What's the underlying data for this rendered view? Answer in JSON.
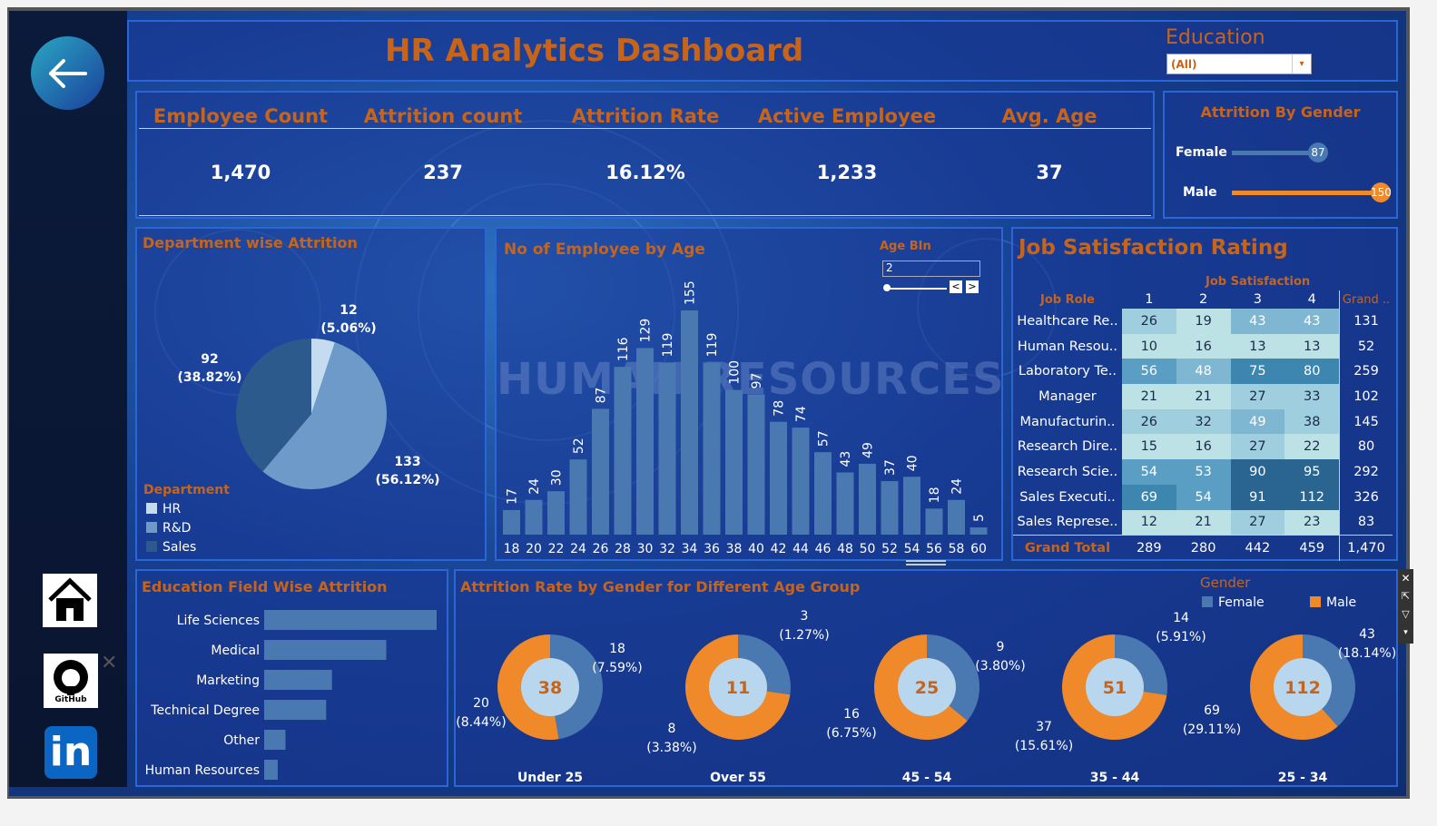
{
  "dashboard": {
    "title": "HR Analytics Dashboard",
    "filter_label": "Education",
    "filter_value": "(All)"
  },
  "kpis": [
    {
      "label": "Employee Count",
      "value": "1,470"
    },
    {
      "label": "Attrition count",
      "value": "237"
    },
    {
      "label": "Attrition Rate",
      "value": "16.12%"
    },
    {
      "label": "Active Employee",
      "value": "1,233"
    },
    {
      "label": "Avg. Age",
      "value": "37"
    }
  ],
  "gender_panel": {
    "title": "Attrition By Gender",
    "female_label": "Female",
    "female_value": "87",
    "male_label": "Male",
    "male_value": "150"
  },
  "dept_panel": {
    "title": "Department wise Attrition",
    "legend_title": "Department",
    "legend": [
      "HR",
      "R&D",
      "Sales"
    ],
    "labels": {
      "hr_count": "12",
      "hr_pct": "(5.06%)",
      "rd_count": "133",
      "rd_pct": "(56.12%)",
      "sales_count": "92",
      "sales_pct": "(38.82%)"
    }
  },
  "age_panel": {
    "title": "No of Employee by Age",
    "bin_label": "Age BIn",
    "bin_value": "2",
    "watermark": "HUMAN RESOURCES"
  },
  "job_panel": {
    "title": "Job Satisfaction Rating",
    "col_group": "Job Satisfaction",
    "row_header": "Job Role",
    "cols": [
      "1",
      "2",
      "3",
      "4",
      "Grand .."
    ],
    "rows": [
      {
        "role": "Healthcare Re..",
        "v": [
          "26",
          "19",
          "43",
          "43"
        ],
        "total": "131"
      },
      {
        "role": "Human Resou..",
        "v": [
          "10",
          "16",
          "13",
          "13"
        ],
        "total": "52"
      },
      {
        "role": "Laboratory Te..",
        "v": [
          "56",
          "48",
          "75",
          "80"
        ],
        "total": "259"
      },
      {
        "role": "Manager",
        "v": [
          "21",
          "21",
          "27",
          "33"
        ],
        "total": "102"
      },
      {
        "role": "Manufacturin..",
        "v": [
          "26",
          "32",
          "49",
          "38"
        ],
        "total": "145"
      },
      {
        "role": "Research Dire..",
        "v": [
          "15",
          "16",
          "27",
          "22"
        ],
        "total": "80"
      },
      {
        "role": "Research Scie..",
        "v": [
          "54",
          "53",
          "90",
          "95"
        ],
        "total": "292"
      },
      {
        "role": "Sales Executi..",
        "v": [
          "69",
          "54",
          "91",
          "112"
        ],
        "total": "326"
      },
      {
        "role": "Sales Represe..",
        "v": [
          "12",
          "21",
          "27",
          "23"
        ],
        "total": "83"
      }
    ],
    "grand_total_label": "Grand Total",
    "grand_totals": [
      "289",
      "280",
      "442",
      "459",
      "1,470"
    ]
  },
  "edu_panel": {
    "title": "Education Field Wise Attrition"
  },
  "agegroup_panel": {
    "title": "Attrition Rate by Gender for Different Age Group",
    "legend_title": "Gender",
    "legend": [
      "Female",
      "Male"
    ]
  },
  "sidebar": {
    "github_label": "GitHub",
    "linkedin_label": "in"
  },
  "colors": {
    "orange": "#c8641a",
    "female": "#4a78b0",
    "male": "#f0892a",
    "light": "#b8d7ee"
  },
  "chart_data": [
    {
      "type": "pie",
      "title": "Department wise Attrition",
      "categories": [
        "HR",
        "R&D",
        "Sales"
      ],
      "values": [
        12,
        133,
        92
      ],
      "labels": [
        "(5.06%)",
        "(56.12%)",
        "(38.82%)"
      ],
      "colors": [
        "#c5dcf0",
        "#6d9ac8",
        "#2d5a8c"
      ]
    },
    {
      "type": "bar",
      "title": "No of Employee by Age",
      "categories": [
        "18",
        "20",
        "22",
        "24",
        "26",
        "28",
        "30",
        "32",
        "34",
        "36",
        "38",
        "40",
        "42",
        "44",
        "46",
        "48",
        "50",
        "52",
        "54",
        "56",
        "58",
        "60"
      ],
      "values": [
        17,
        24,
        30,
        52,
        87,
        116,
        129,
        119,
        155,
        119,
        100,
        97,
        78,
        74,
        57,
        43,
        49,
        37,
        40,
        18,
        24,
        5
      ],
      "ylim": [
        0,
        160
      ]
    },
    {
      "type": "bar",
      "title": "Education Field Wise Attrition",
      "orientation": "horizontal",
      "categories": [
        "Life Sciences",
        "Medical",
        "Marketing",
        "Technical Degree",
        "Other",
        "Human Resources"
      ],
      "values": [
        89,
        63,
        35,
        32,
        11,
        7
      ]
    },
    {
      "type": "pie",
      "title": "Attrition Rate by Gender for Different Age Group",
      "groups": [
        {
          "name": "Under 25",
          "total": "38",
          "female": 18,
          "female_pct": "(7.59%)",
          "male": 20,
          "male_pct": "(8.44%)"
        },
        {
          "name": "Over 55",
          "total": "11",
          "female": 3,
          "female_pct": "(1.27%)",
          "male": 8,
          "male_pct": "(3.38%)"
        },
        {
          "name": "45 - 54",
          "total": "25",
          "female": 9,
          "female_pct": "(3.80%)",
          "male": 16,
          "male_pct": "(6.75%)"
        },
        {
          "name": "35 - 44",
          "total": "51",
          "female": 14,
          "female_pct": "(5.91%)",
          "male": 37,
          "male_pct": "(15.61%)"
        },
        {
          "name": "25 - 34",
          "total": "112",
          "female": 43,
          "female_pct": "(18.14%)",
          "male": 69,
          "male_pct": "(29.11%)"
        }
      ]
    }
  ]
}
